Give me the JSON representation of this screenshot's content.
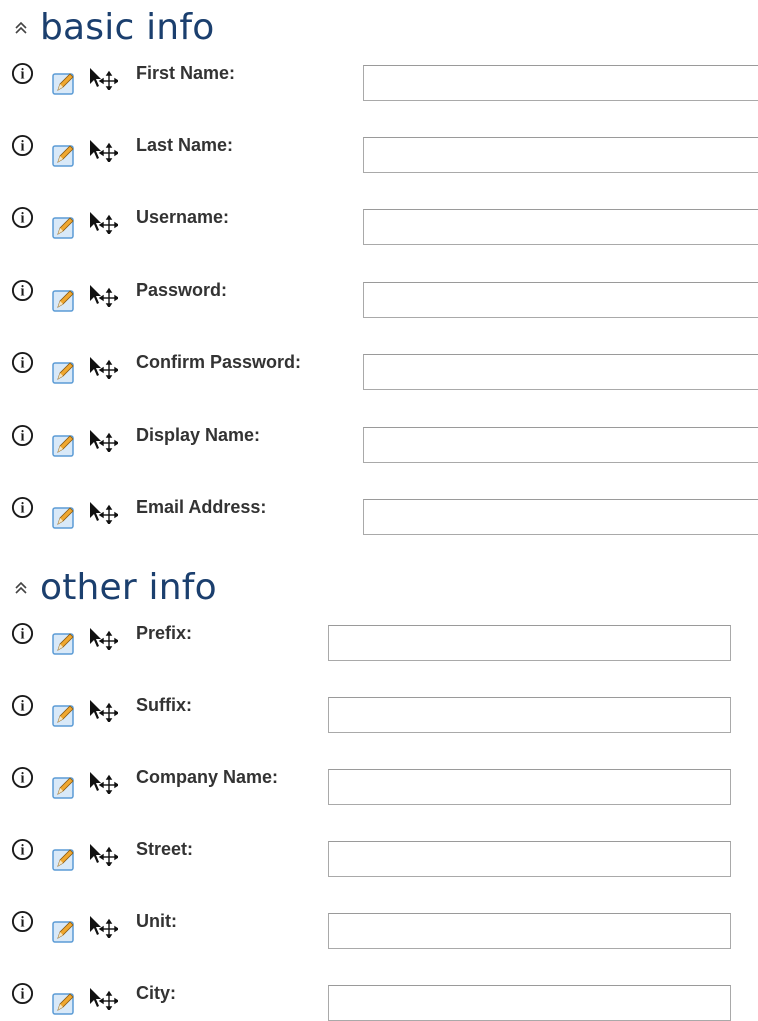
{
  "sections": [
    {
      "title": "basic info",
      "collapse_icon": "double-chevron-up-icon",
      "fields": [
        {
          "label": "First Name:",
          "value": "",
          "placeholder": ""
        },
        {
          "label": "Last Name:",
          "value": "",
          "placeholder": ""
        },
        {
          "label": "Username:",
          "value": "",
          "placeholder": ""
        },
        {
          "label": "Password:",
          "value": "",
          "placeholder": ""
        },
        {
          "label": "Confirm Password:",
          "value": "",
          "placeholder": ""
        },
        {
          "label": "Display Name:",
          "value": "",
          "placeholder": ""
        },
        {
          "label": "Email Address:",
          "value": "",
          "placeholder": ""
        }
      ]
    },
    {
      "title": "other info",
      "collapse_icon": "double-chevron-up-icon",
      "fields": [
        {
          "label": "Prefix:",
          "value": "",
          "placeholder": ""
        },
        {
          "label": "Suffix:",
          "value": "",
          "placeholder": ""
        },
        {
          "label": "Company Name:",
          "value": "",
          "placeholder": ""
        },
        {
          "label": "Street:",
          "value": "",
          "placeholder": ""
        },
        {
          "label": "Unit:",
          "value": "",
          "placeholder": ""
        },
        {
          "label": "City:",
          "value": "",
          "placeholder": ""
        }
      ]
    }
  ],
  "row_icons": [
    "info-icon",
    "edit-icon",
    "move-icon"
  ],
  "colors": {
    "section_title": "#1b3f6e",
    "label": "#333333",
    "input_border": "#a9a9a9",
    "edit_icon_bg": "#5b9bd5",
    "edit_icon_pencil": "#f0a830"
  }
}
